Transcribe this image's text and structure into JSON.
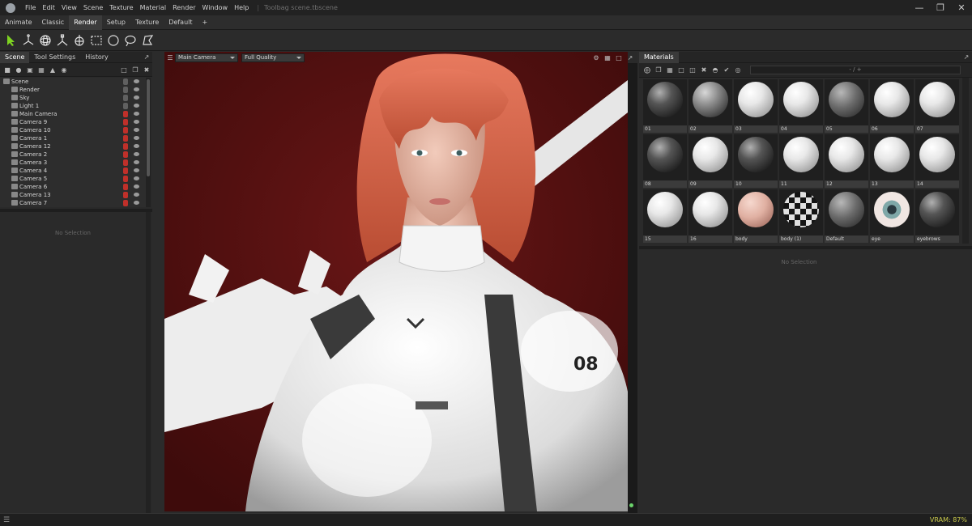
{
  "menubar": {
    "items": [
      "File",
      "Edit",
      "View",
      "Scene",
      "Texture",
      "Material",
      "Render",
      "Window",
      "Help"
    ],
    "title": "Toolbag scene.tbscene"
  },
  "workspace_tabs": {
    "items": [
      "Animate",
      "Classic",
      "Render",
      "Setup",
      "Texture",
      "Default"
    ],
    "active": "Render",
    "add_label": "+"
  },
  "toolbar": {
    "tools": [
      "select-tool-icon",
      "move-tool-icon",
      "rotate-tool-icon",
      "scale-tool-icon",
      "transform-tool-icon",
      "rect-select-icon",
      "circle-select-icon",
      "lasso-select-icon",
      "polygon-select-icon"
    ]
  },
  "left_panel": {
    "tabs": [
      "Scene",
      "Tool Settings",
      "History"
    ],
    "active_tab": "Scene",
    "tree": [
      {
        "label": "Scene",
        "icon": "scene-icon",
        "lock": "grey"
      },
      {
        "label": "Render",
        "icon": "render-icon",
        "lock": "grey"
      },
      {
        "label": "Sky",
        "icon": "sky-icon",
        "lock": "grey"
      },
      {
        "label": "Light 1",
        "icon": "light-icon",
        "lock": "grey"
      },
      {
        "label": "Main Camera",
        "icon": "camera-icon",
        "lock": "red"
      },
      {
        "label": "Camera 9",
        "icon": "camera-icon",
        "lock": "red"
      },
      {
        "label": "Camera 10",
        "icon": "camera-icon",
        "lock": "red"
      },
      {
        "label": "Camera 1",
        "icon": "camera-icon",
        "lock": "red"
      },
      {
        "label": "Camera 12",
        "icon": "camera-icon",
        "lock": "red"
      },
      {
        "label": "Camera 2",
        "icon": "camera-icon",
        "lock": "red"
      },
      {
        "label": "Camera 3",
        "icon": "camera-icon",
        "lock": "red"
      },
      {
        "label": "Camera 4",
        "icon": "camera-icon",
        "lock": "red"
      },
      {
        "label": "Camera 5",
        "icon": "camera-icon",
        "lock": "red"
      },
      {
        "label": "Camera 6",
        "icon": "camera-icon",
        "lock": "red"
      },
      {
        "label": "Camera 13",
        "icon": "camera-icon",
        "lock": "red"
      },
      {
        "label": "Camera 7",
        "icon": "camera-icon",
        "lock": "red"
      }
    ],
    "no_selection": "No Selection"
  },
  "viewport": {
    "camera": "Main Camera",
    "quality": "Full Quality",
    "background_color": "#5c1212"
  },
  "right_panel": {
    "tab": "Materials",
    "search_value": "- / +",
    "no_selection": "No Selection",
    "materials": [
      {
        "label": "01",
        "style": "s-dark"
      },
      {
        "label": "02",
        "style": "s-mid"
      },
      {
        "label": "03",
        "style": "s-white"
      },
      {
        "label": "04",
        "style": "s-white"
      },
      {
        "label": "05",
        "style": "s-grey"
      },
      {
        "label": "06",
        "style": "s-white"
      },
      {
        "label": "07",
        "style": "s-white"
      },
      {
        "label": "08",
        "style": "s-dark"
      },
      {
        "label": "09",
        "style": "s-white"
      },
      {
        "label": "10",
        "style": "s-dark"
      },
      {
        "label": "11",
        "style": "s-white"
      },
      {
        "label": "12",
        "style": "s-white"
      },
      {
        "label": "13",
        "style": "s-white"
      },
      {
        "label": "14",
        "style": "s-white"
      },
      {
        "label": "15",
        "style": "s-white"
      },
      {
        "label": "16",
        "style": "s-white"
      },
      {
        "label": "body",
        "style": "s-skin"
      },
      {
        "label": "body (1)",
        "style": "s-check"
      },
      {
        "label": "Default",
        "style": "s-grey"
      },
      {
        "label": "eye",
        "style": "s-eye"
      },
      {
        "label": "eyebrows",
        "style": "s-dark"
      }
    ]
  },
  "statusbar": {
    "vram": "VRAM: 87%"
  }
}
